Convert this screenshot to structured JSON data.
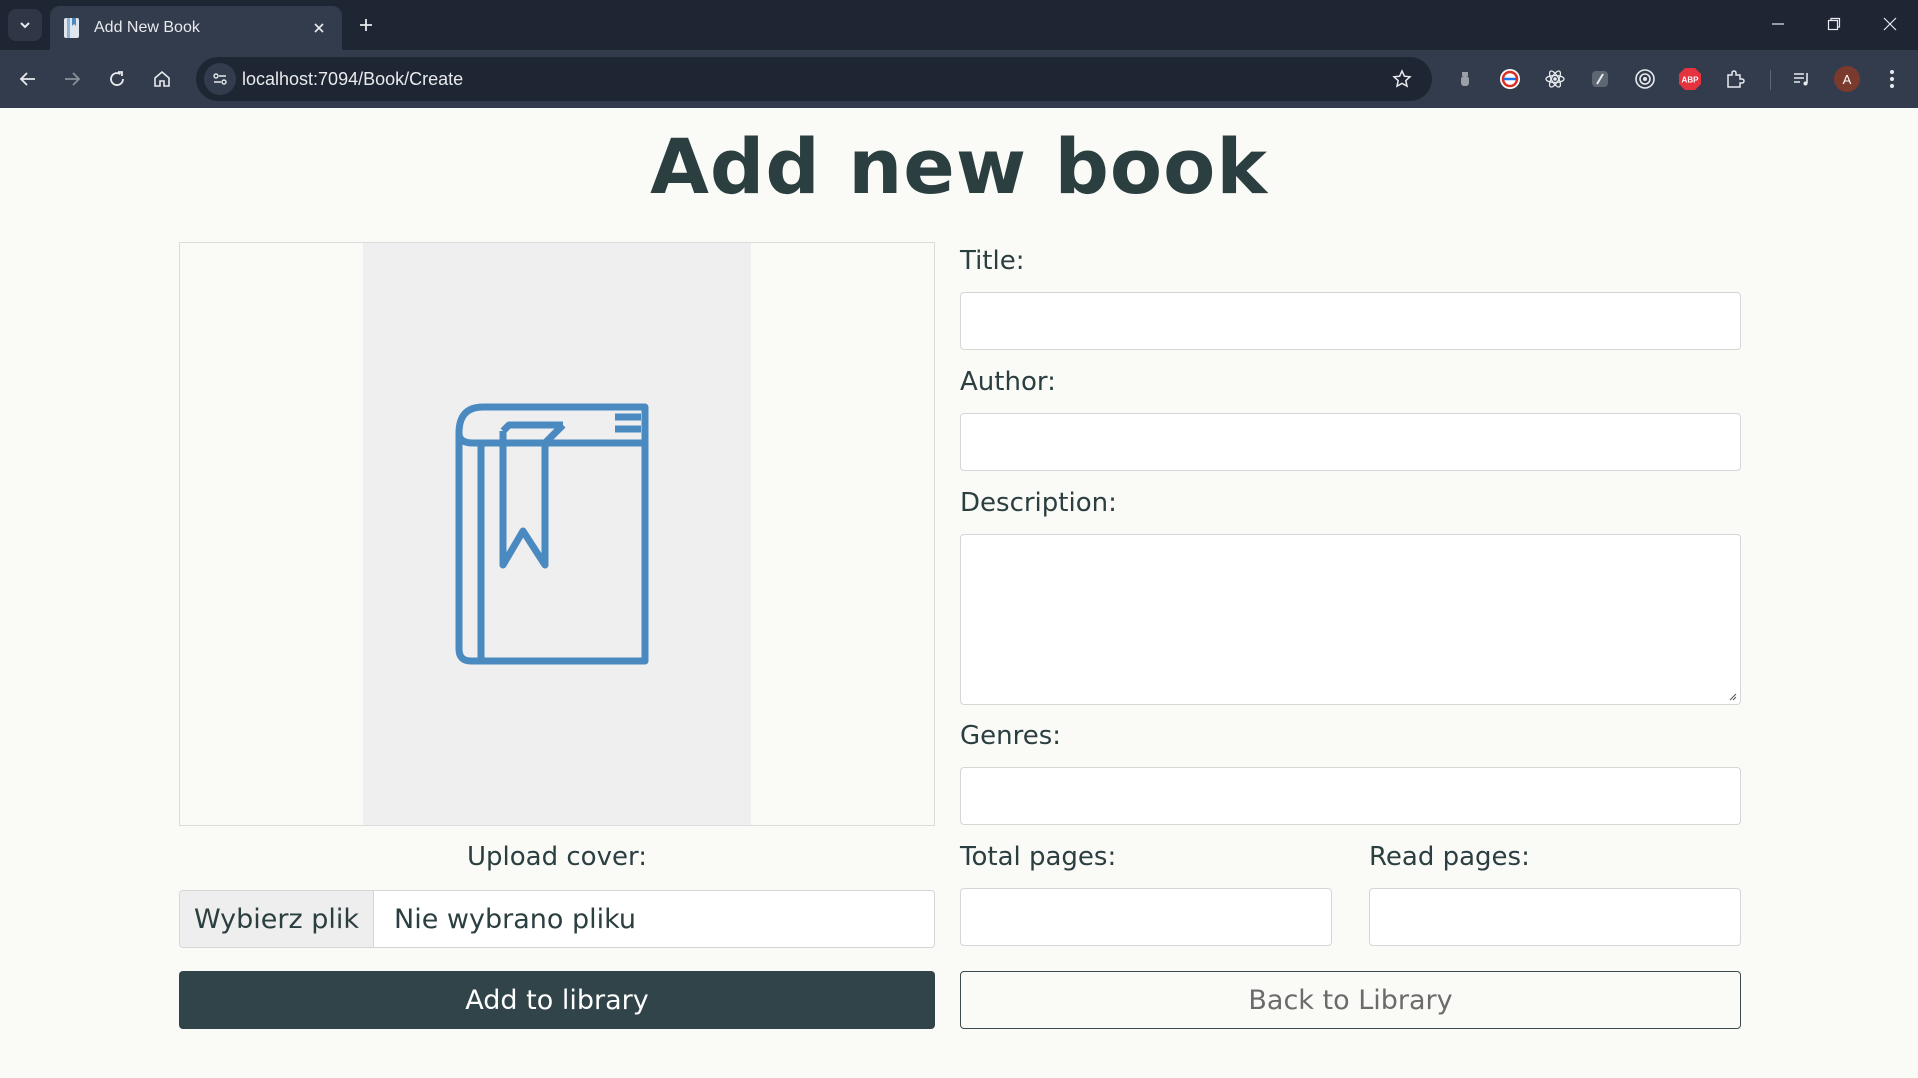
{
  "browser": {
    "tab_title": "Add New Book",
    "url": "localhost:7094/Book/Create",
    "profile_initial": "A",
    "abp_label": "ABP"
  },
  "page": {
    "title": "Add new book",
    "upload_label": "Upload cover:",
    "file_button": "Wybierz plik",
    "file_status": "Nie wybrano pliku",
    "add_button": "Add to library",
    "back_button": "Back to Library"
  },
  "form": {
    "title_label": "Title:",
    "title_value": "",
    "author_label": "Author:",
    "author_value": "",
    "description_label": "Description:",
    "description_value": "",
    "genres_label": "Genres:",
    "genres_value": "",
    "total_pages_label": "Total pages:",
    "total_pages_value": "",
    "read_pages_label": "Read pages:",
    "read_pages_value": ""
  },
  "colors": {
    "accent": "#30444a",
    "icon_blue": "#4a8ac0",
    "chrome_dark": "#1f2633",
    "chrome_toolbar": "#333c4c"
  },
  "icons": [
    "tab-list-icon",
    "favicon-icon",
    "close-icon",
    "plus-icon",
    "minimize-icon",
    "restore-icon",
    "back-icon",
    "forward-icon",
    "reload-icon",
    "home-icon",
    "site-info-icon",
    "star-icon",
    "extension-icon",
    "puzzle-icon",
    "media-icon",
    "menu-icon",
    "book-icon"
  ]
}
